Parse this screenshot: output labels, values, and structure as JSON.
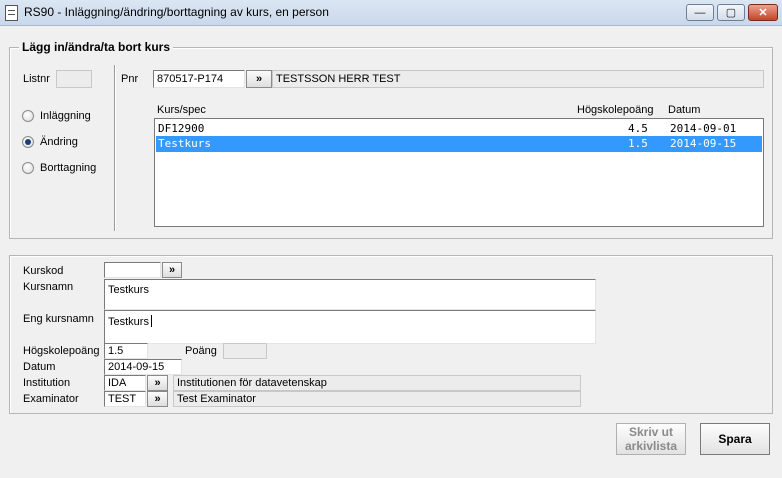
{
  "window": {
    "title": "RS90 - Inläggning/ändring/borttagning av kurs, en person",
    "minimize_label": "—",
    "maximize_label": "▢",
    "close_label": "✕"
  },
  "top_group": {
    "legend": "Lägg in/ändra/ta bort kurs",
    "listnr_label": "Listnr",
    "listnr_value": "",
    "pnr_label": "Pnr",
    "pnr_value": "870517-P174",
    "lookup_label": "»",
    "person_name": "TESTSSON HERR TEST",
    "radios": [
      {
        "label": "Inläggning",
        "checked": false
      },
      {
        "label": "Ändring",
        "checked": true
      },
      {
        "label": "Borttagning",
        "checked": false
      }
    ],
    "list_headers": {
      "course": "Kurs/spec",
      "credits": "Högskolepoäng",
      "date": "Datum"
    },
    "courses": [
      {
        "course": "DF12900",
        "credits": "4.5",
        "date": "2014-09-01",
        "selected": false
      },
      {
        "course": "Testkurs",
        "credits": "1.5",
        "date": "2014-09-15",
        "selected": true
      }
    ]
  },
  "detail": {
    "kurskod_label": "Kurskod",
    "kurskod_value": "",
    "lookup_label": "»",
    "kursnamn_label": "Kursnamn",
    "kursnamn_value": "Testkurs",
    "eng_label": "Eng kursnamn",
    "eng_value": "Testkurs",
    "hp_label": "Högskolepoäng",
    "hp_value": "1.5",
    "poang_label": "Poäng",
    "poang_value": "",
    "datum_label": "Datum",
    "datum_value": "2014-09-15",
    "institution_label": "Institution",
    "institution_code": "IDA",
    "institution_name": "Institutionen för datavetenskap",
    "examinator_label": "Examinator",
    "examinator_code": "TEST",
    "examinator_name": "Test Examinator"
  },
  "buttons": {
    "print_line1": "Skriv ut",
    "print_line2": "arkivlista",
    "save": "Spara"
  },
  "colors": {
    "selection": "#3399ff",
    "background": "#f0f0f0"
  }
}
